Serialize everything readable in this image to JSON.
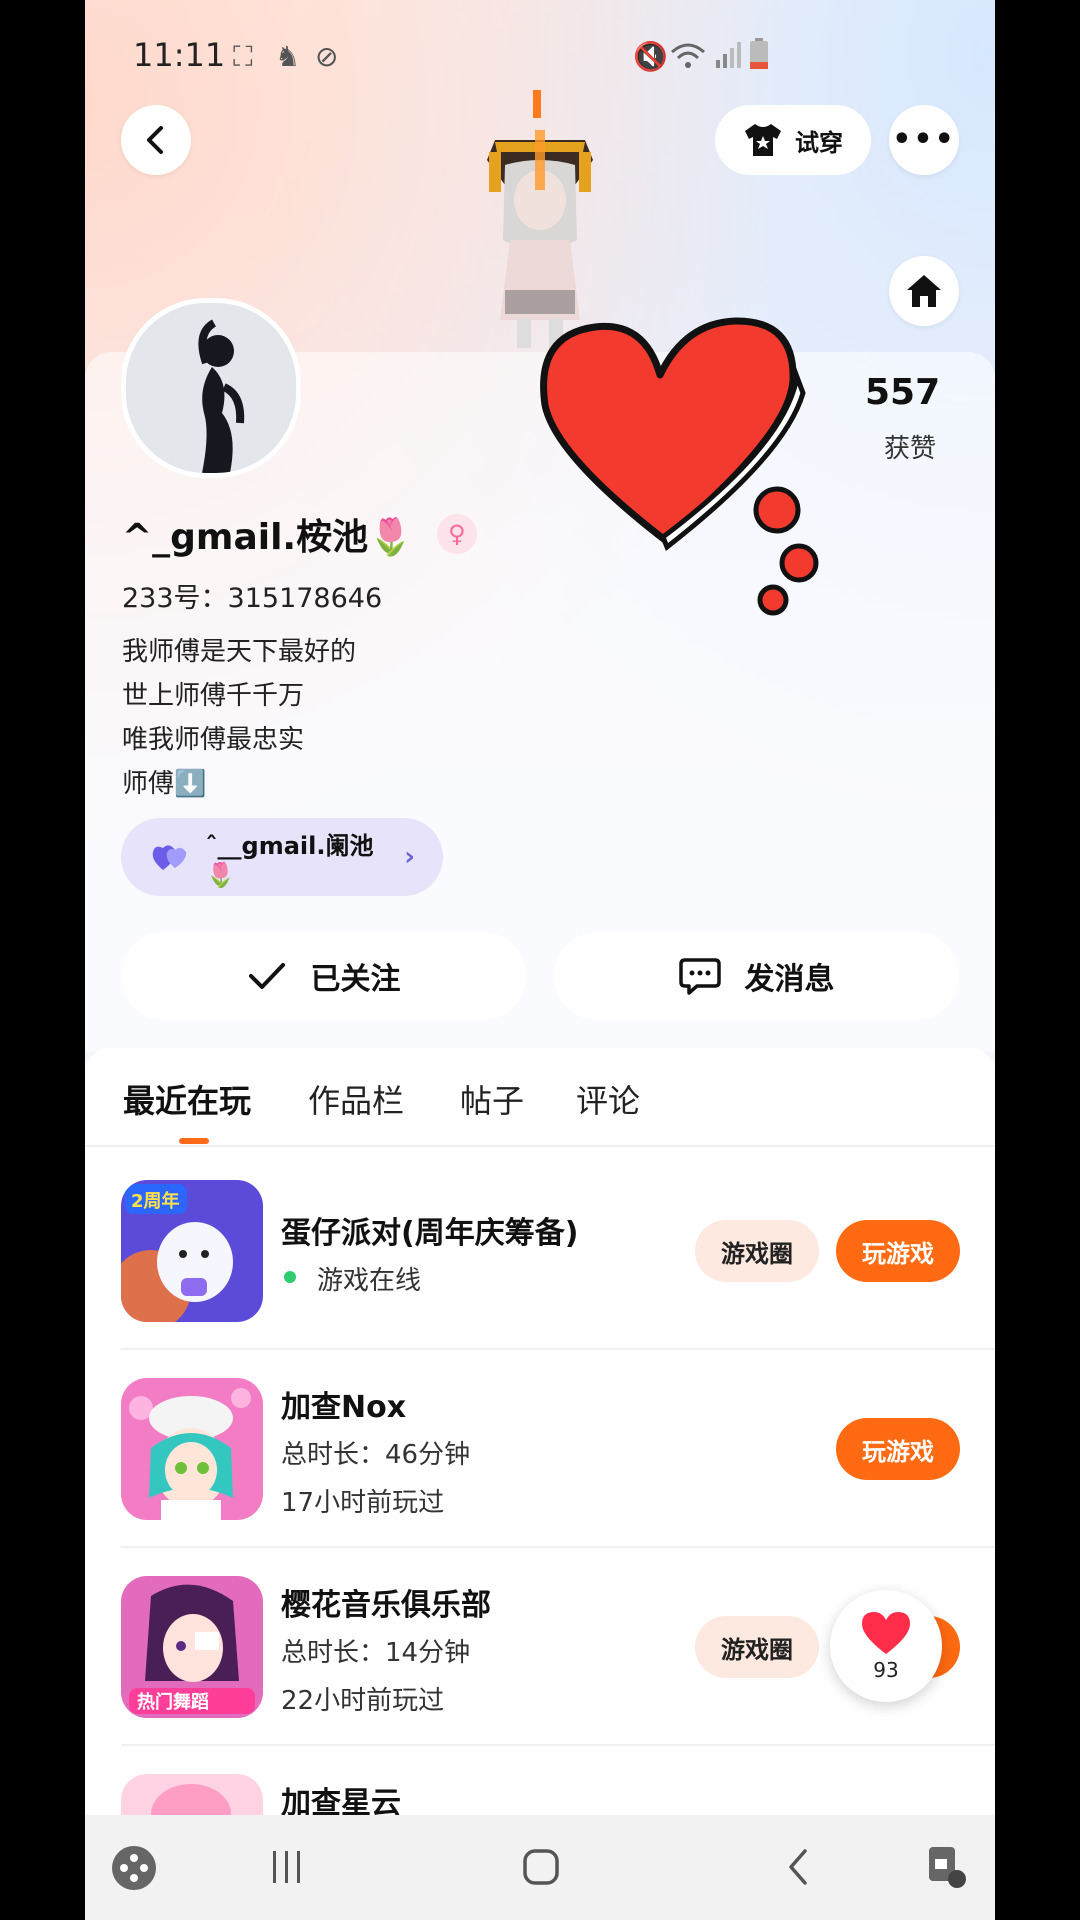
{
  "status_bar": {
    "time": "11:11"
  },
  "header": {
    "try_on_label": "试穿"
  },
  "profile": {
    "likes_count": "557",
    "likes_label": "获赞",
    "name": "^_gmail.桉池🌷",
    "uid": "233号：315178646",
    "bio": [
      "我师傅是天下最好的",
      "世上师傅千千万",
      "唯我师傅最忠实",
      "师傅⬇️"
    ],
    "cp_tag": "ˆ__gmail.阑池🌷"
  },
  "actions": {
    "follow_label": "已关注",
    "message_label": "发消息"
  },
  "tabs": [
    "最近在玩",
    "作品栏",
    "帖子",
    "评论"
  ],
  "games": [
    {
      "title": "蛋仔派对(周年庆筹备)",
      "line1": "游戏在线",
      "circle_label": "游戏圈",
      "play_label": "玩游戏"
    },
    {
      "title": "加查Nox",
      "line1": "总时长：46分钟",
      "line2": "17小时前玩过",
      "play_label": "玩游戏"
    },
    {
      "title": "樱花音乐俱乐部",
      "line1": "总时长：14分钟",
      "line2": "22小时前玩过",
      "circle_label": "游戏圈"
    },
    {
      "title": "加查星云"
    }
  ],
  "floating_like": {
    "count": "93"
  },
  "icon_badges": {
    "game1_badge": "2周年",
    "game3_badge": "热门舞蹈"
  },
  "colors": {
    "accent": "#ff6a12",
    "online": "#2ecc71",
    "cp_tag_bg": "#e6e3fa"
  }
}
